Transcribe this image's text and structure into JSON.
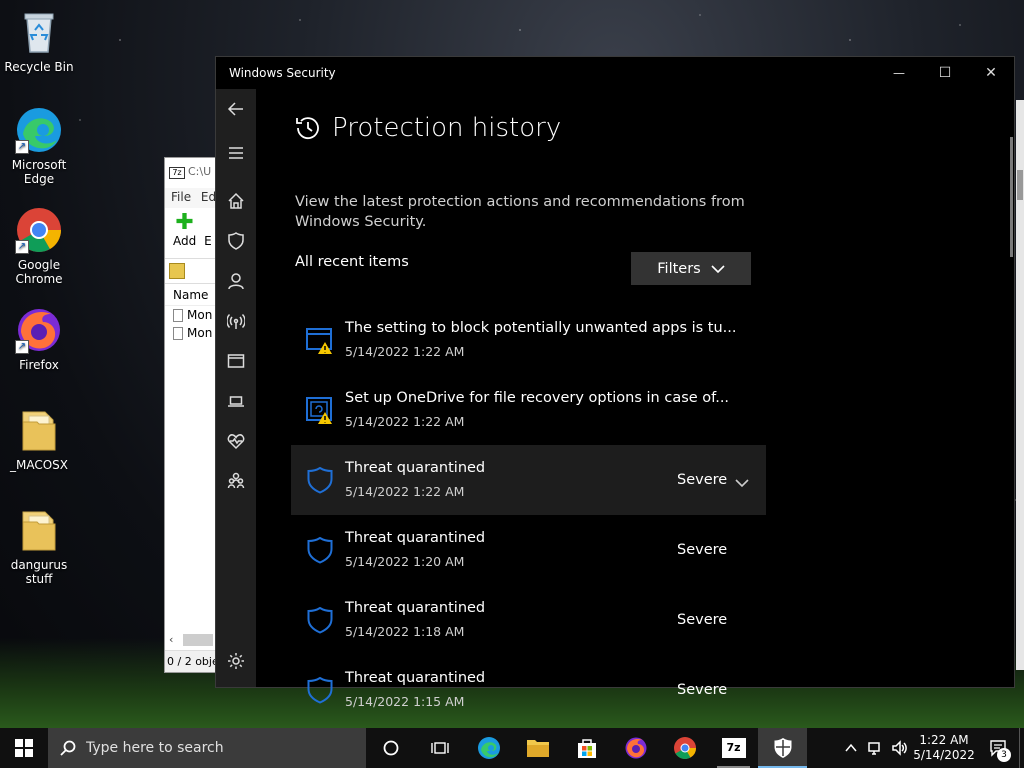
{
  "desktop": {
    "icons": [
      {
        "label": "Recycle Bin",
        "icon": "recycle-bin-icon"
      },
      {
        "label": "Microsoft Edge",
        "icon": "edge-icon"
      },
      {
        "label": "Google Chrome",
        "icon": "chrome-icon"
      },
      {
        "label": "Firefox",
        "icon": "firefox-icon"
      },
      {
        "label": "_MACOSX",
        "icon": "folder-icon"
      },
      {
        "label": "dangurus stuff",
        "icon": "folder-icon"
      }
    ]
  },
  "zip_window": {
    "title": "C:\\U",
    "menu": {
      "file": "File",
      "edit": "Ed"
    },
    "toolbar": {
      "add": "Add",
      "extract": "E"
    },
    "column_name": "Name",
    "rows": [
      "Mon",
      "Mon"
    ],
    "status": "0 / 2 obje"
  },
  "security": {
    "window_title": "Windows Security",
    "controls": {
      "minimize": "—",
      "maximize": "☐",
      "close": "✕"
    },
    "page_title": "Protection history",
    "description": "View the latest protection actions and recommendations from Windows Security.",
    "recent_label": "All recent items",
    "filters_label": "Filters",
    "items": [
      {
        "title": "The setting to block potentially unwanted apps is tu...",
        "date": "5/14/2022 1:22 AM",
        "severity": "",
        "icon": "app-browser-warning-icon"
      },
      {
        "title": "Set up OneDrive for file recovery options in case of...",
        "date": "5/14/2022 1:22 AM",
        "severity": "",
        "icon": "ransomware-warning-icon"
      },
      {
        "title": "Threat quarantined",
        "date": "5/14/2022 1:22 AM",
        "severity": "Severe",
        "icon": "shield-icon"
      },
      {
        "title": "Threat quarantined",
        "date": "5/14/2022 1:20 AM",
        "severity": "Severe",
        "icon": "shield-icon"
      },
      {
        "title": "Threat quarantined",
        "date": "5/14/2022 1:18 AM",
        "severity": "Severe",
        "icon": "shield-icon"
      },
      {
        "title": "Threat quarantined",
        "date": "5/14/2022 1:15 AM",
        "severity": "Severe",
        "icon": "shield-icon"
      }
    ]
  },
  "taskbar": {
    "search_placeholder": "Type here to search",
    "time": "1:22 AM",
    "date": "5/14/2022",
    "notification_count": "3",
    "zip_label": "7z"
  },
  "colors": {
    "accent": "#76b9ed",
    "shield_blue": "#1f6fd6",
    "warning_yellow": "#f6c700"
  }
}
